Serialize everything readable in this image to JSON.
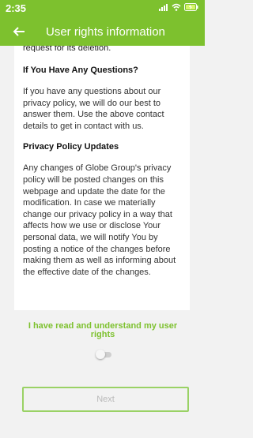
{
  "status_bar": {
    "time": "2:35"
  },
  "header": {
    "title": "User rights information"
  },
  "content": {
    "cut_text": "request for its deletion.",
    "sections": [
      {
        "heading": "If You Have Any Questions?",
        "body": "If you have any questions about our privacy policy, we will do our best to answer them. Use the above contact details to get in contact with us."
      },
      {
        "heading": "Privacy Policy Updates",
        "body": "Any changes of Globe Group's privacy policy will be posted changes on this webpage and update the date for the modification. In case we materially change our privacy policy in a way that affects how we use or disclose Your personal data, we will notify You by posting a notice of the changes before making them as well as informing about the effective date of the changes."
      }
    ]
  },
  "agreement": {
    "label": "I have read and understand my user rights",
    "toggle_on": false
  },
  "next_button": {
    "label": "Next"
  },
  "colors": {
    "accent": "#7dc12e"
  },
  "icons": [
    "back-arrow-icon",
    "signal-icon",
    "wifi-icon",
    "battery-icon"
  ]
}
